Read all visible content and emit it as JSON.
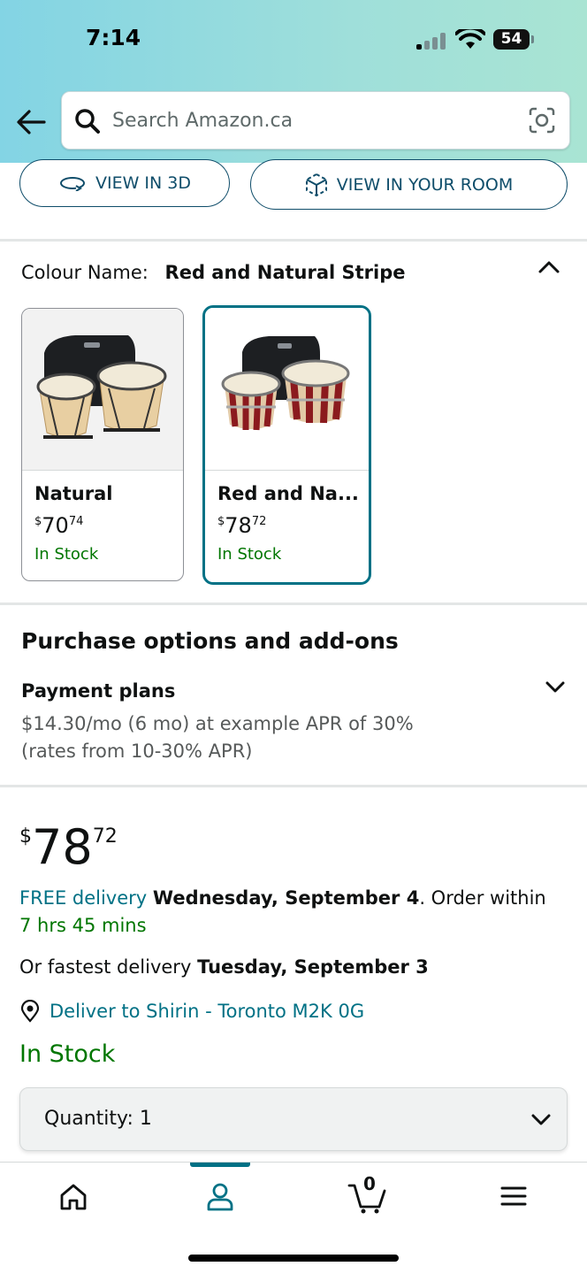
{
  "status_bar": {
    "time": "7:14",
    "battery": "54"
  },
  "header": {
    "search_placeholder": "Search Amazon.ca"
  },
  "view_buttons": {
    "view_3d": "VIEW IN 3D",
    "view_room": "VIEW IN YOUR ROOM"
  },
  "colour": {
    "label": "Colour Name:",
    "selected": "Red and Natural Stripe",
    "options": [
      {
        "name": "Natural",
        "price_symbol": "$",
        "price_whole": "70",
        "price_fraction": "74",
        "stock": "In Stock"
      },
      {
        "name": "Red and Na...",
        "price_symbol": "$",
        "price_whole": "78",
        "price_fraction": "72",
        "stock": "In Stock"
      }
    ]
  },
  "purchase_options": {
    "title": "Purchase options and add-ons",
    "payment_plans_title": "Payment plans",
    "payment_line1": "$14.30/mo (6 mo) at example APR of 30%",
    "payment_line2": "(rates from 10-30% APR)"
  },
  "price": {
    "symbol": "$",
    "whole": "78",
    "fraction": "72"
  },
  "delivery": {
    "free_label": "FREE delivery",
    "date": "Wednesday, September 4",
    "order_within": ". Order within ",
    "countdown": "7 hrs 45 mins",
    "fastest_prefix": "Or fastest delivery ",
    "fastest_date": "Tuesday, September 3",
    "deliver_to": "Deliver to Shirin - Toronto M2K 0G"
  },
  "stock_status": "In Stock",
  "quantity": {
    "label": "Quantity:",
    "value": "1"
  },
  "nav": {
    "cart_count": "0"
  },
  "colors": {
    "teal": "#007185",
    "green": "#007600",
    "accent_nav": "#007185"
  }
}
